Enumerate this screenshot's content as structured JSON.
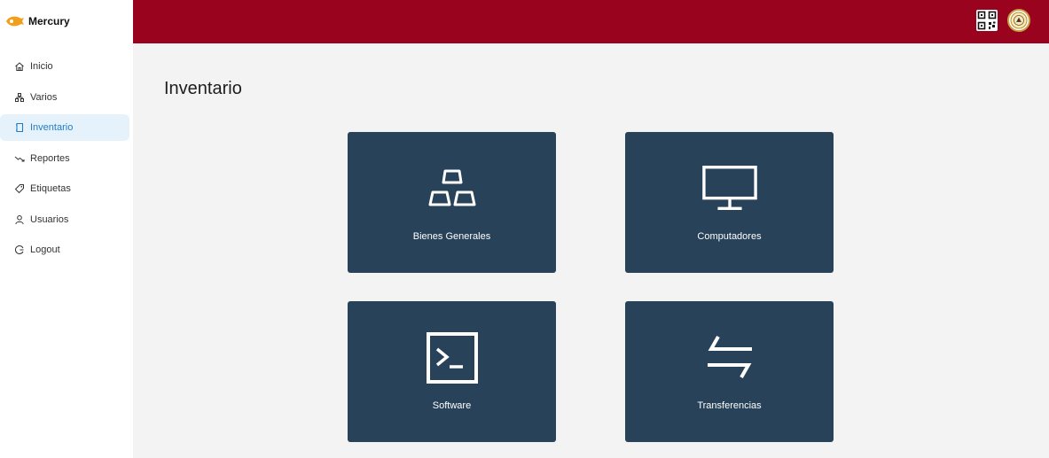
{
  "brand": {
    "name": "Mercury",
    "logo_icon": "mercury-logo-icon"
  },
  "sidebar": {
    "items": [
      {
        "label": "Inicio",
        "icon": "home-icon",
        "active": false
      },
      {
        "label": "Varios",
        "icon": "hierarchy-icon",
        "active": false
      },
      {
        "label": "Inventario",
        "icon": "book-icon",
        "active": true
      },
      {
        "label": "Reportes",
        "icon": "trend-down-icon",
        "active": false
      },
      {
        "label": "Etiquetas",
        "icon": "tag-icon",
        "active": false
      },
      {
        "label": "Usuarios",
        "icon": "user-icon",
        "active": false
      },
      {
        "label": "Logout",
        "icon": "logout-icon",
        "active": false
      }
    ]
  },
  "header": {
    "qr_icon": "qr-code-icon",
    "avatar_icon": "institution-seal-icon",
    "color": "#9a031e"
  },
  "main": {
    "title": "Inventario",
    "cards": [
      {
        "label": "Bienes Generales",
        "icon": "gold-bars-icon"
      },
      {
        "label": "Computadores",
        "icon": "monitor-icon"
      },
      {
        "label": "Software",
        "icon": "terminal-icon"
      },
      {
        "label": "Transferencias",
        "icon": "transfer-arrows-icon"
      }
    ]
  },
  "colors": {
    "card": "#274259",
    "accent": "#1e7cc8",
    "active_bg": "#e6f2fb"
  }
}
